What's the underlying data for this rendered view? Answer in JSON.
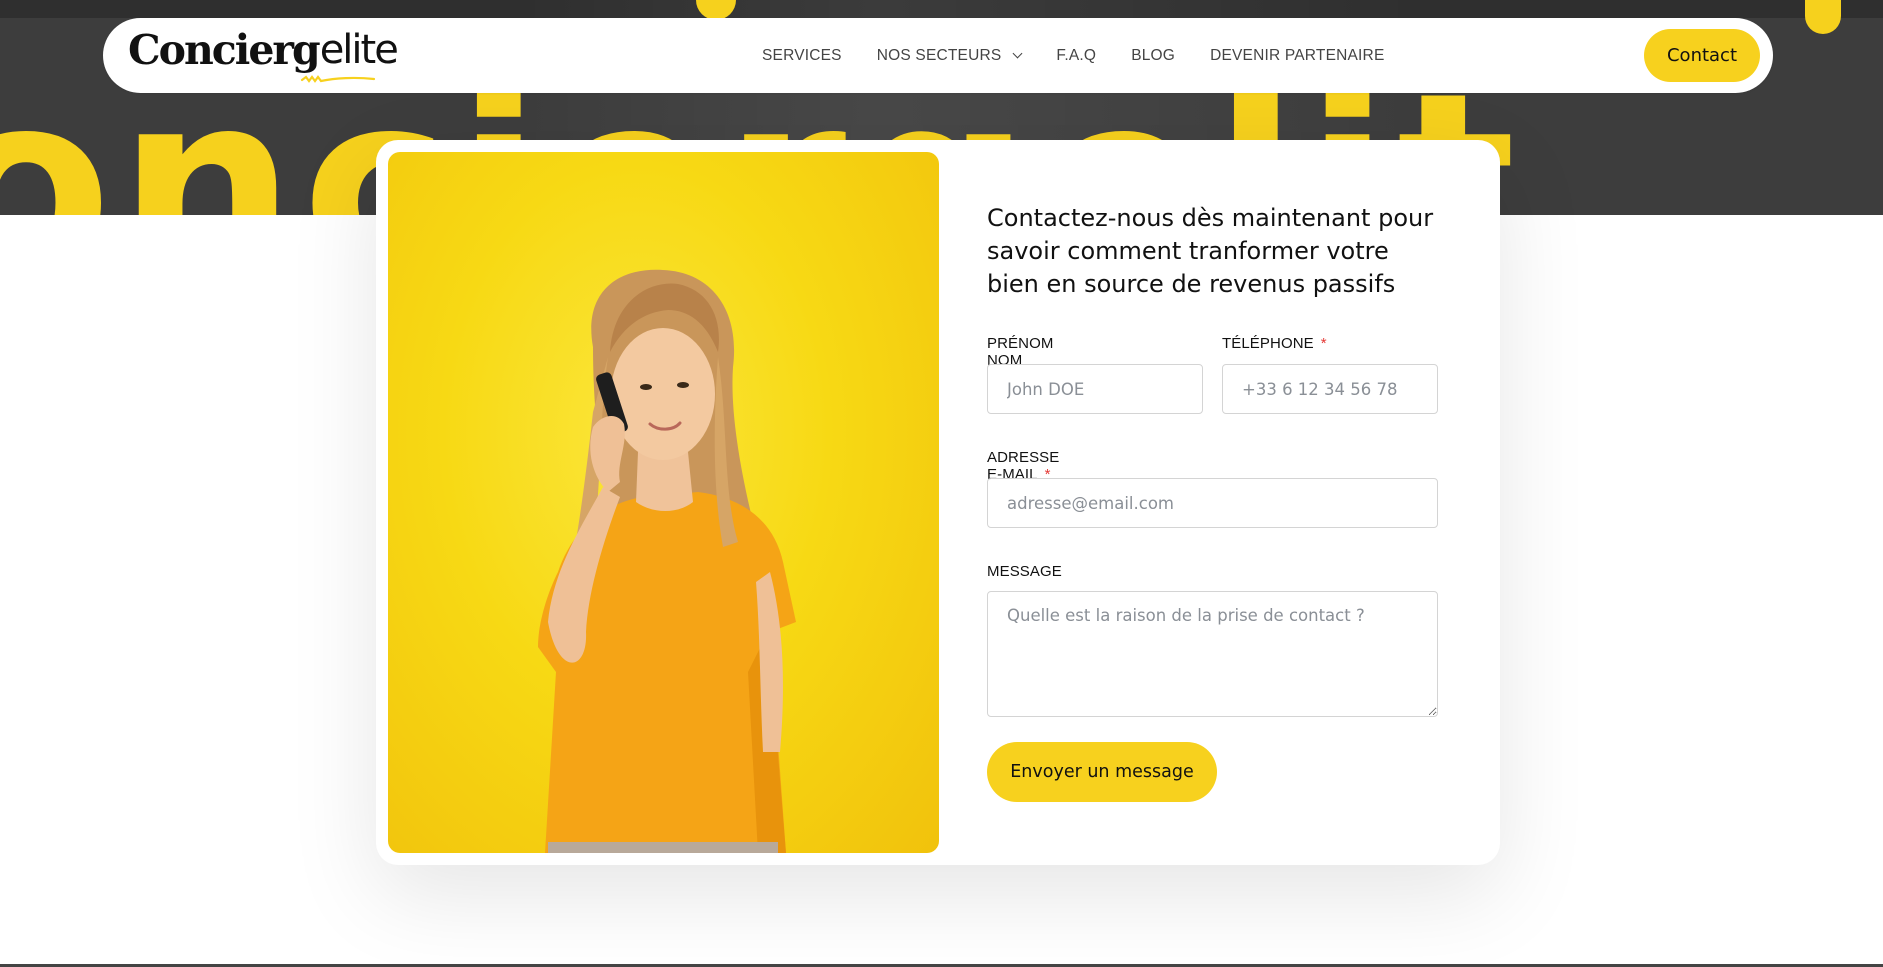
{
  "brand": {
    "logo_part1": "Concierg",
    "logo_part2": "elite",
    "accent_color": "#f7d11e"
  },
  "hero": {
    "background_word": "onciergelit"
  },
  "nav": {
    "items": [
      {
        "label": "SERVICES"
      },
      {
        "label": "NOS SECTEURS",
        "has_dropdown": true
      },
      {
        "label": "F.A.Q"
      },
      {
        "label": "BLOG"
      },
      {
        "label": "DEVENIR PARTENAIRE"
      }
    ],
    "contact_button": "Contact"
  },
  "form": {
    "heading": "Contactez-nous dès maintenant pour savoir comment tranformer votre bien en source de revenus passifs",
    "name": {
      "label": "PRÉNOM NOM",
      "placeholder": "John DOE"
    },
    "phone": {
      "label": "TÉLÉPHONE",
      "required_mark": "*",
      "placeholder": "+33 6 12 34 56 78"
    },
    "email": {
      "label": "ADRESSE E-MAIL",
      "required_mark": "*",
      "placeholder": "adresse@email.com"
    },
    "message": {
      "label": "MESSAGE",
      "placeholder": "Quelle est la raison de la prise de contact ?"
    },
    "submit": "Envoyer un message"
  }
}
